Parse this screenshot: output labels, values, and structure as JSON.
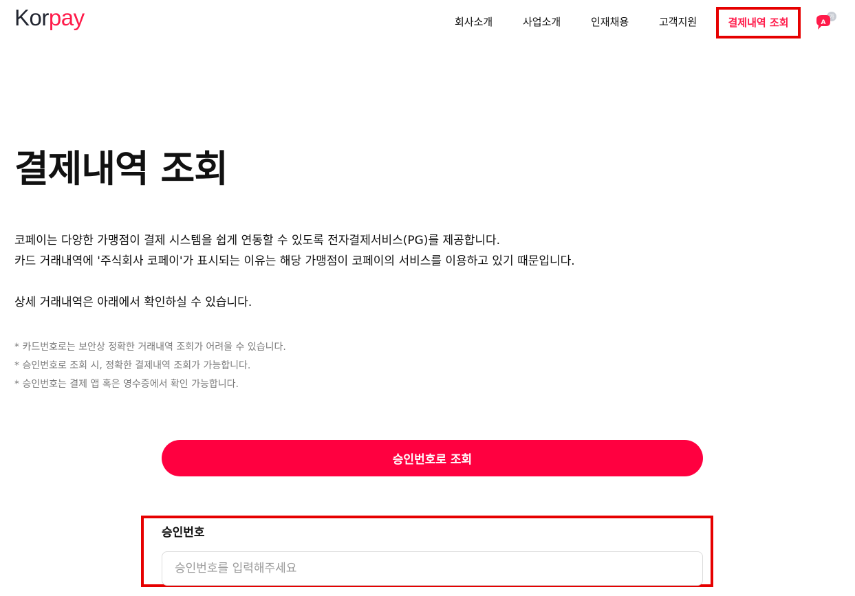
{
  "brand": {
    "logo_part1": "Kor",
    "logo_part2": "pay"
  },
  "nav": {
    "items": [
      "회사소개",
      "사업소개",
      "인재채용",
      "고객지원"
    ],
    "active": "결제내역 조회",
    "language_icon": "translate-icon",
    "language_badge": "가"
  },
  "main": {
    "title": "결제내역 조회",
    "description": [
      "코페이는 다양한 가맹점이 결제 시스템을 쉽게 연동할 수 있도록 전자결제서비스(PG)를 제공합니다.",
      "카드 거래내역에 '주식회사 코페이'가 표시되는 이유는 해당 가맹점이 코페이의 서비스를 이용하고 있기 때문입니다.",
      "상세 거래내역은 아래에서 확인하실 수 있습니다."
    ],
    "notes": [
      "* 카드번호로는 보안상 정확한 거래내역 조회가 어려울 수 있습니다.",
      "* 승인번호로 조회 시, 정확한 결제내역 조회가 가능합니다.",
      "* 승인번호는 결제 앱 혹은 영수증에서 확인 가능합니다."
    ],
    "search_button": "승인번호로 조회",
    "form": {
      "label": "승인번호",
      "value": "",
      "placeholder": "승인번호를 입력해주세요"
    }
  },
  "colors": {
    "accent": "#ff0040",
    "highlight_border": "#e60000",
    "logo_dark": "#222631"
  }
}
